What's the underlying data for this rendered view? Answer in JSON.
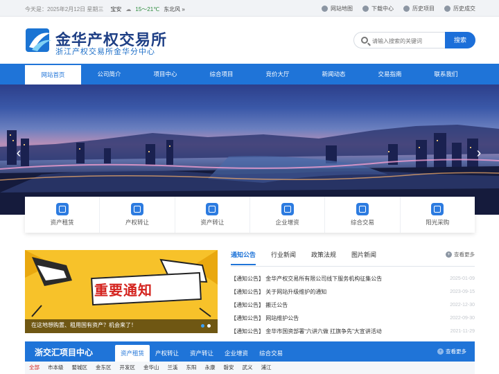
{
  "topbar": {
    "date_text": "今天是：2025年2月12日 星期三",
    "city": "宝安",
    "temp": "15～21℃",
    "wind": "东北风 »",
    "links": [
      "网站地图",
      "下载中心",
      "历史项目",
      "历史成交"
    ]
  },
  "header": {
    "title": "金华产权交易所",
    "subtitle": "浙江产权交易所金华分中心",
    "search_placeholder": "请输入搜索的关键词",
    "search_button": "搜索"
  },
  "nav": {
    "items": [
      "网站首页",
      "公司简介",
      "项目中心",
      "综合项目",
      "竞价大厅",
      "新闻动态",
      "交易指南",
      "联系我们"
    ]
  },
  "services": [
    "资产租赁",
    "产权转让",
    "资产转让",
    "企业增资",
    "综合交易",
    "阳光采购"
  ],
  "notice_image": {
    "headline": "重要通知",
    "caption": "在这地想购置、租用国有资产？机会来了！"
  },
  "news": {
    "tabs": [
      "通知公告",
      "行业新闻",
      "政策法规",
      "图片新闻"
    ],
    "more": "查看更多",
    "items": [
      {
        "title": "【通知公告】 金华产权交易所有限公司线下服务机构征集公告",
        "date": "2025-01-09"
      },
      {
        "title": "【通知公告】 关于网站升级维护的通知",
        "date": "2023-09-15"
      },
      {
        "title": "【通知公告】 搬迁公告",
        "date": "2022-12-30"
      },
      {
        "title": "【通知公告】 网站维护公告",
        "date": "2022-09-30"
      },
      {
        "title": "【通知公告】 金华市国资部署“六讲六做 扛旗争先”大宣讲活动",
        "date": "2021-11-29"
      }
    ]
  },
  "project_center": {
    "title": "浙交汇项目中心",
    "tabs": [
      "资产租赁",
      "产权转让",
      "资产转让",
      "企业增资",
      "综合交易"
    ],
    "more": "查看更多",
    "areas": [
      "全部",
      "市本级",
      "婺城区",
      "金东区",
      "开发区",
      "金华山",
      "兰溪",
      "东阳",
      "永康",
      "磐安",
      "武义",
      "浦江"
    ]
  }
}
